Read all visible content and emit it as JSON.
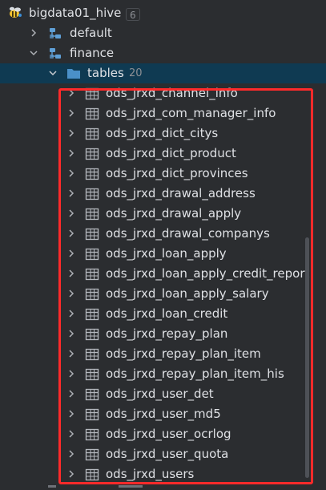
{
  "tree": {
    "connection": {
      "name": "bigdata01_hive",
      "count": "6",
      "icon": "hive-bee-icon"
    },
    "schemas": [
      {
        "name": "default",
        "icon": "schema-icon",
        "expanded": false
      },
      {
        "name": "finance",
        "icon": "schema-icon",
        "expanded": true
      }
    ],
    "tables_folder": {
      "label": "tables",
      "count": "20",
      "icon": "folder-icon"
    },
    "tables": [
      "ods_jrxd_channel_info",
      "ods_jrxd_com_manager_info",
      "ods_jrxd_dict_citys",
      "ods_jrxd_dict_product",
      "ods_jrxd_dict_provinces",
      "ods_jrxd_drawal_address",
      "ods_jrxd_drawal_apply",
      "ods_jrxd_drawal_companys",
      "ods_jrxd_loan_apply",
      "ods_jrxd_loan_apply_credit_report",
      "ods_jrxd_loan_apply_salary",
      "ods_jrxd_loan_credit",
      "ods_jrxd_repay_plan",
      "ods_jrxd_repay_plan_item",
      "ods_jrxd_repay_plan_item_his",
      "ods_jrxd_user_det",
      "ods_jrxd_user_md5",
      "ods_jrxd_user_ocrlog",
      "ods_jrxd_user_quota",
      "ods_jrxd_users"
    ]
  },
  "colors": {
    "background": "#2b2d30",
    "selection": "#0f3a52",
    "highlight": "#ff2a2a",
    "folder": "#4a90c8",
    "schema": "#5f9fd6"
  }
}
